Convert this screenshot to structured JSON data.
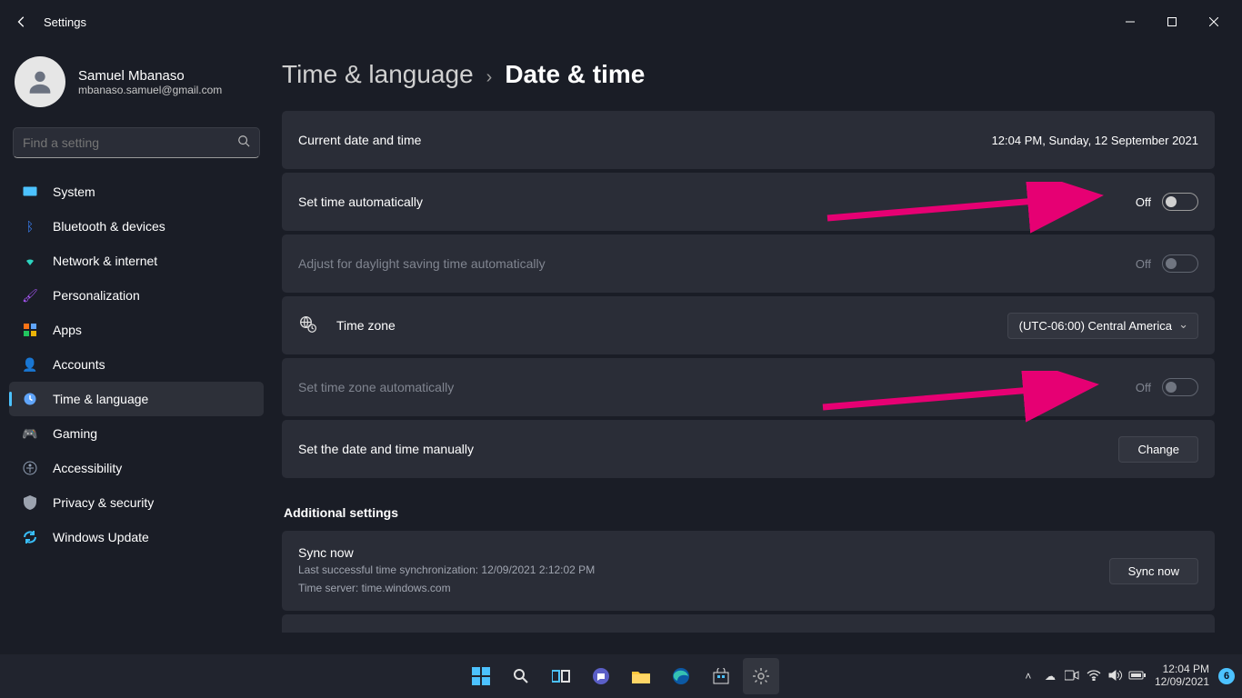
{
  "titlebar": {
    "title": "Settings"
  },
  "account": {
    "name": "Samuel Mbanaso",
    "email": "mbanaso.samuel@gmail.com"
  },
  "search": {
    "placeholder": "Find a setting"
  },
  "nav": [
    {
      "label": "System",
      "color": "#4cc2ff"
    },
    {
      "label": "Bluetooth & devices",
      "color": "#3b82f6"
    },
    {
      "label": "Network & internet",
      "color": "#2dd4bf"
    },
    {
      "label": "Personalization",
      "color": "#a855f7"
    },
    {
      "label": "Apps",
      "color": "#f97316"
    },
    {
      "label": "Accounts",
      "color": "#22c55e"
    },
    {
      "label": "Time & language",
      "color": "#60a5fa"
    },
    {
      "label": "Gaming",
      "color": "#9ca3af"
    },
    {
      "label": "Accessibility",
      "color": "#94a3b8"
    },
    {
      "label": "Privacy & security",
      "color": "#9ca3af"
    },
    {
      "label": "Windows Update",
      "color": "#38bdf8"
    }
  ],
  "breadcrumb": {
    "parent": "Time & language",
    "current": "Date & time"
  },
  "settings": {
    "current_label": "Current date and time",
    "current_value": "12:04 PM, Sunday, 12 September 2021",
    "auto_time_label": "Set time automatically",
    "auto_time_state": "Off",
    "dst_label": "Adjust for daylight saving time automatically",
    "dst_state": "Off",
    "tz_label": "Time zone",
    "tz_value": "(UTC-06:00) Central America",
    "auto_tz_label": "Set time zone automatically",
    "auto_tz_state": "Off",
    "manual_label": "Set the date and time manually",
    "change_btn": "Change",
    "additional_header": "Additional settings",
    "sync_title": "Sync now",
    "sync_last": "Last successful time synchronization: 12/09/2021 2:12:02 PM",
    "sync_server": "Time server: time.windows.com",
    "sync_btn": "Sync now"
  },
  "taskbar": {
    "time": "12:04 PM",
    "date": "12/09/2021",
    "notif_count": "6"
  }
}
